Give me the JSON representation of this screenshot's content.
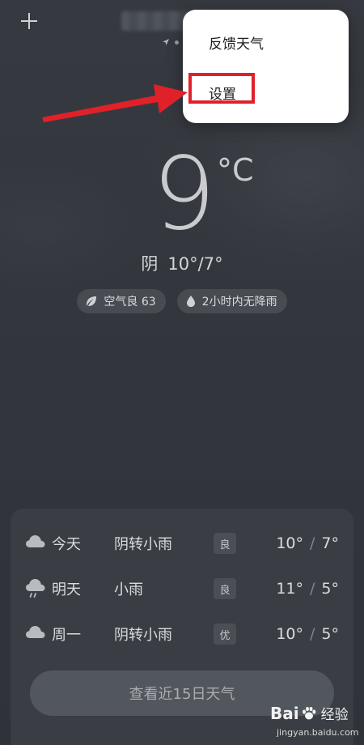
{
  "header": {
    "add_icon": "plus-icon",
    "location_icon": "location-arrow-icon"
  },
  "menu": {
    "feedback_label": "反馈天气",
    "settings_label": "设置"
  },
  "current": {
    "temperature": "9",
    "unit": "°C",
    "condition": "阴",
    "range": "10°/7°",
    "air_quality": "空气良 63",
    "precip": "2小时内无降雨"
  },
  "forecast": {
    "rows": [
      {
        "day": "今天",
        "desc": "阴转小雨",
        "aq": "良",
        "high": "10°",
        "low": "7°",
        "icon": "cloud-icon"
      },
      {
        "day": "明天",
        "desc": "小雨",
        "aq": "良",
        "high": "11°",
        "low": "5°",
        "icon": "rain-cloud-icon"
      },
      {
        "day": "周一",
        "desc": "阴转小雨",
        "aq": "优",
        "high": "10°",
        "low": "5°",
        "icon": "cloud-icon"
      }
    ],
    "sep": "/",
    "button_label": "查看近15日天气"
  },
  "watermark": {
    "brand": "Bai",
    "brand2": "经验",
    "url": "jingyan.baidu.com"
  },
  "colors": {
    "annotation_red": "#e0212a",
    "background": "#34383e"
  }
}
